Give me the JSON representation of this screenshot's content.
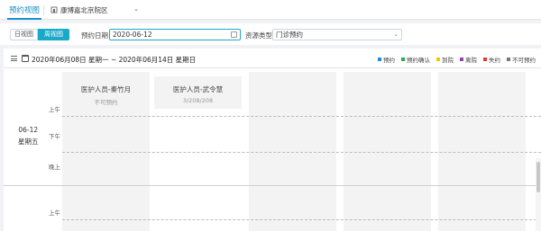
{
  "topbar": {
    "active_tab": "预约视图",
    "hospital": "康博嘉北京院区"
  },
  "filter": {
    "day_view_label": "日视图",
    "week_view_label": "周视图",
    "date_label": "预约日期",
    "date_value": "2020-06-12",
    "resource_type_label": "资源类型",
    "resource_type_value": "门诊预约"
  },
  "panel": {
    "range_title": "2020年06月08日 星期一 ~ 2020年06月14日 星期日",
    "legend": [
      {
        "label": "预约",
        "color": "#1e88e5"
      },
      {
        "label": "预约确认",
        "color": "#22b14c"
      },
      {
        "label": "到院",
        "color": "#f7c600"
      },
      {
        "label": "离院",
        "color": "#8e44ad"
      },
      {
        "label": "失约",
        "color": "#e53935"
      },
      {
        "label": "不可预约",
        "color": "#777777"
      }
    ]
  },
  "columns": [
    {
      "name": "医护人员-秦竹月",
      "sub": "不可预约"
    },
    {
      "name": "医护人员-武令慧",
      "sub": "3/208/208"
    },
    {
      "name": "",
      "sub": ""
    },
    {
      "name": "",
      "sub": ""
    },
    {
      "name": "",
      "sub": ""
    }
  ],
  "day_row": {
    "date": "06-12",
    "weekday": "星期五"
  },
  "time_slots": [
    "上午",
    "下午",
    "晚上",
    "上午"
  ],
  "colors": {
    "accent": "#1aa9c8"
  }
}
